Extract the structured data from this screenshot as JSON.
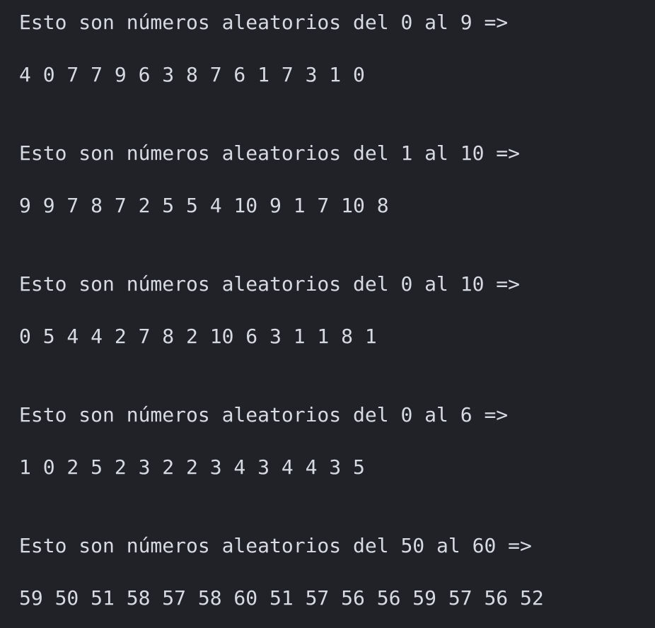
{
  "output": [
    {
      "heading": "Esto son números aleatorios del 0 al 9 =>",
      "numbers": "4 0 7 7 9 6 3 8 7 6 1 7 3 1 0"
    },
    {
      "heading": "Esto son números aleatorios del 1 al 10 =>",
      "numbers": "9 9 7 8 7 2 5 5 4 10 9 1 7 10 8"
    },
    {
      "heading": "Esto son números aleatorios del 0 al 10 =>",
      "numbers": "0 5 4 4 2 7 8 2 10 6 3 1 1 8 1"
    },
    {
      "heading": "Esto son números aleatorios del 0 al 6 =>",
      "numbers": "1 0 2 5 2 3 2 2 3 4 3 4 4 3 5"
    },
    {
      "heading": "Esto son números aleatorios del 50 al 60 =>",
      "numbers": "59 50 51 58 57 58 60 51 57 56 56 59 57 56 52"
    }
  ],
  "colors": {
    "background": "#202227",
    "text": "#d7dae0"
  }
}
